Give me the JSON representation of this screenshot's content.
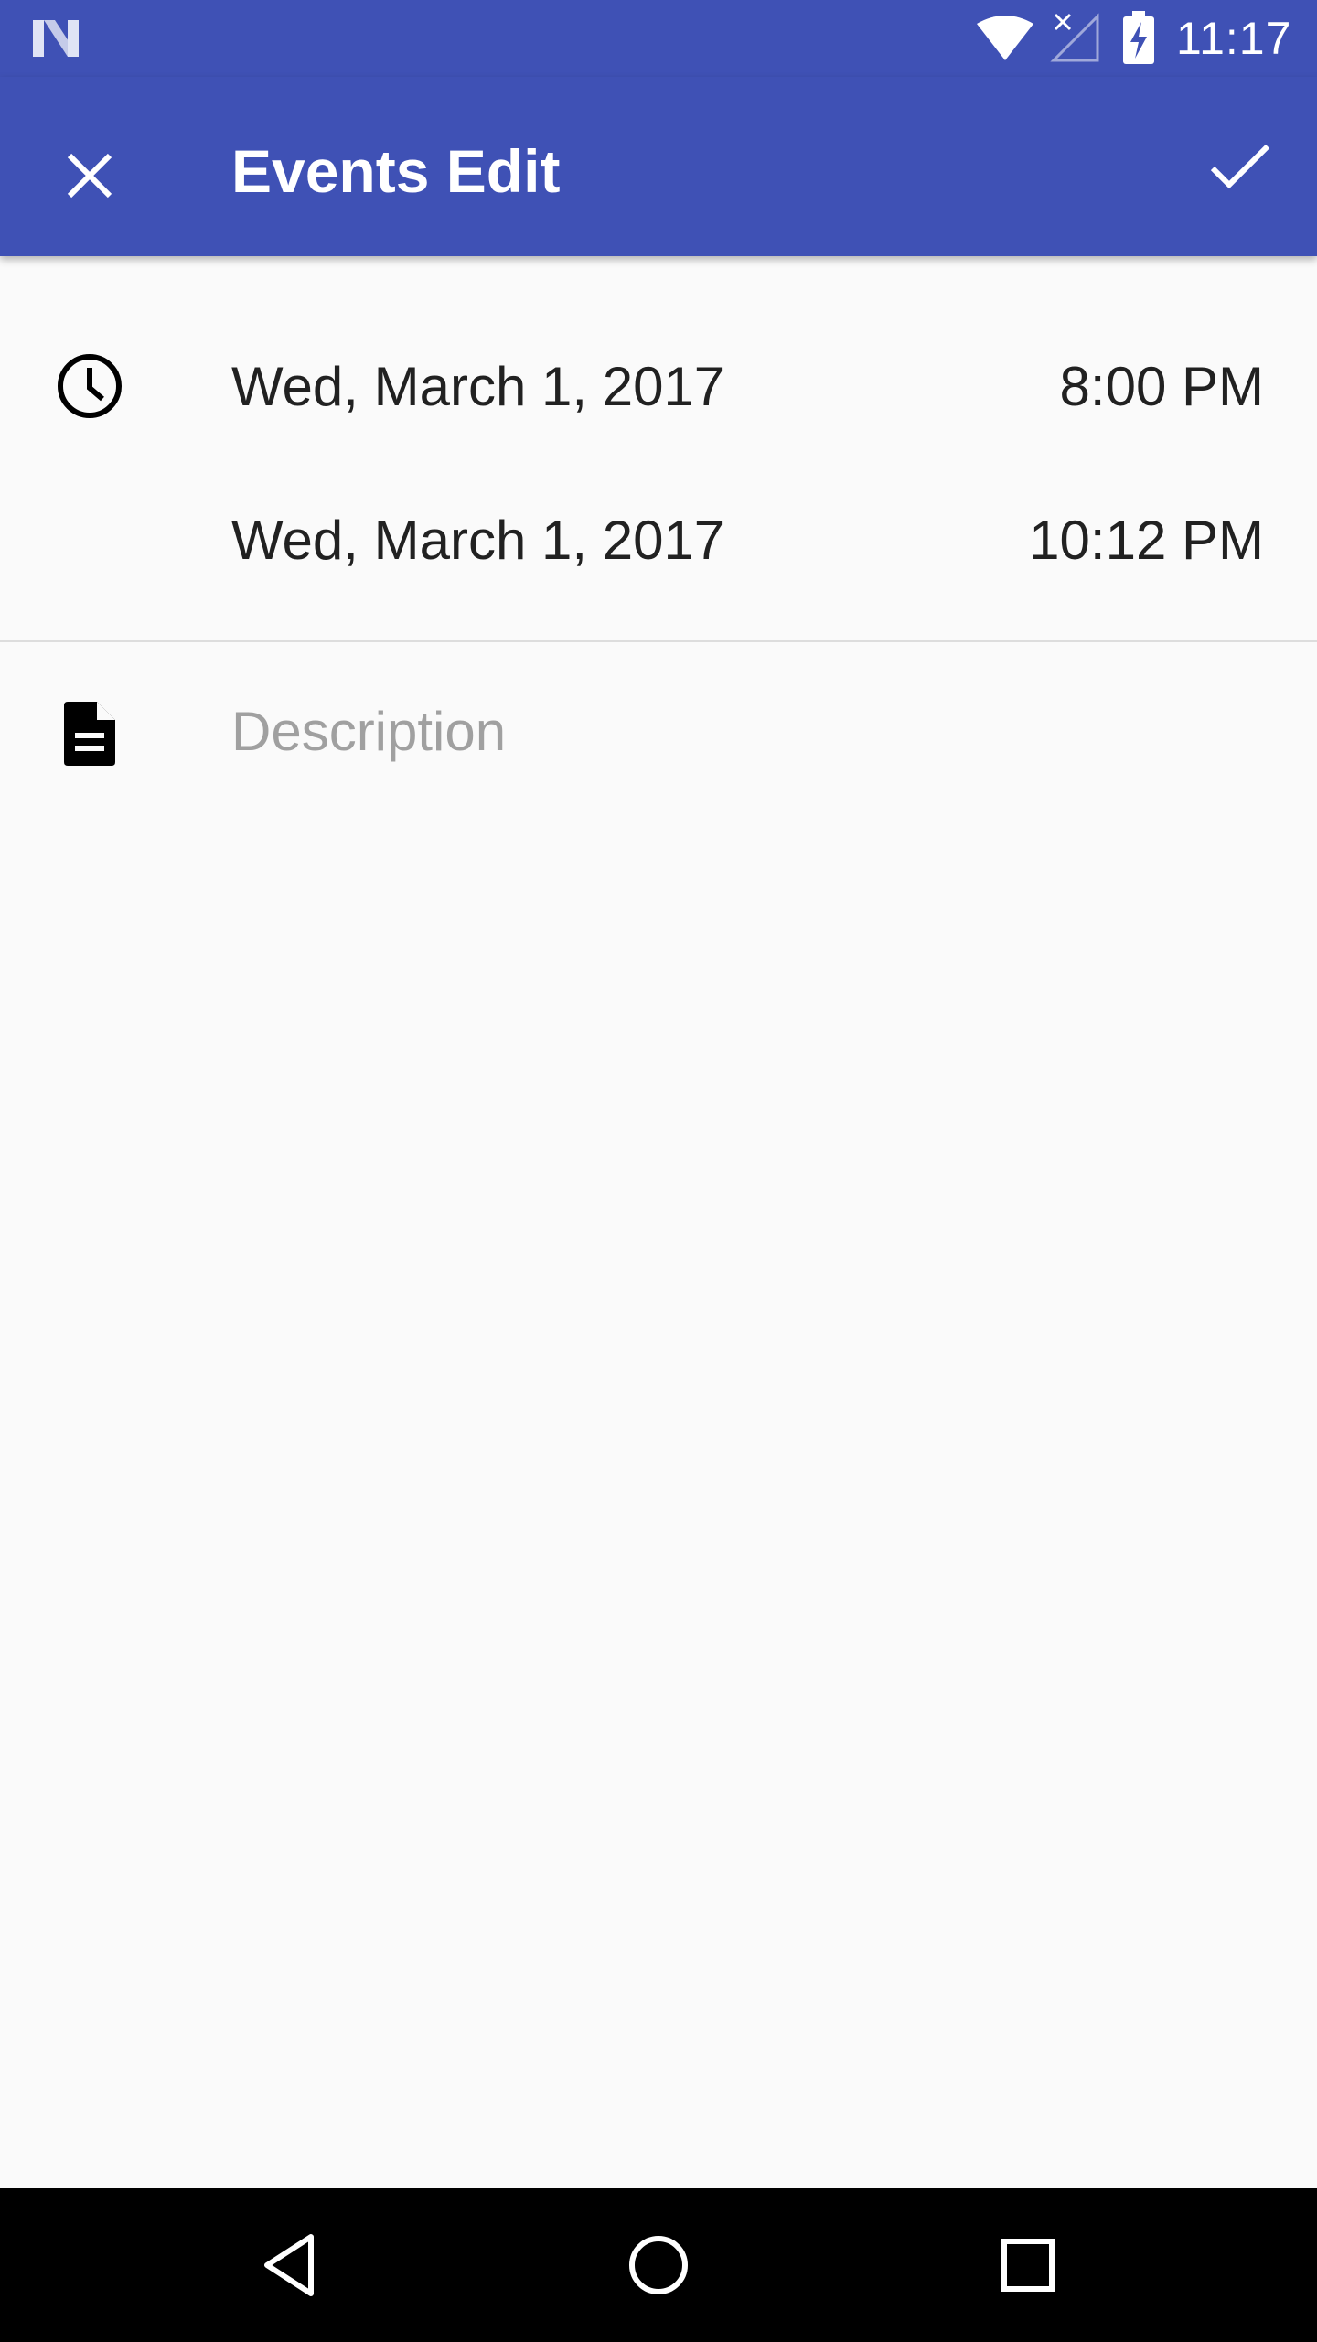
{
  "status_bar": {
    "time": "11:17",
    "icons": [
      "n-logo-icon",
      "wifi-icon",
      "no-signal-icon",
      "battery-charging-icon"
    ]
  },
  "app_bar": {
    "title": "Events Edit",
    "close_icon": "close-icon",
    "done_icon": "check-icon",
    "background": "#3f51b5"
  },
  "event_time": {
    "icon": "clock-icon",
    "start": {
      "date": "Wed, March 1, 2017",
      "time": "8:00 PM"
    },
    "end": {
      "date": "Wed, March 1, 2017",
      "time": "10:12 PM"
    }
  },
  "description": {
    "icon": "document-icon",
    "value": "",
    "placeholder": "Description"
  },
  "nav_bar": {
    "icons": [
      "back-icon",
      "home-icon",
      "recents-icon"
    ]
  }
}
